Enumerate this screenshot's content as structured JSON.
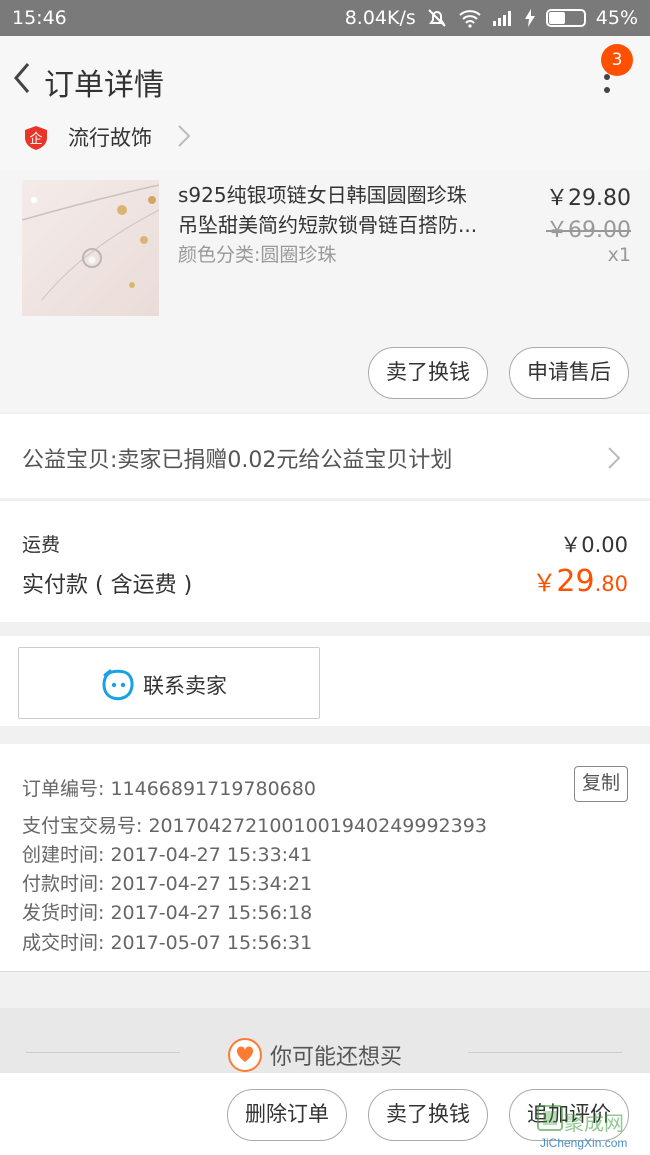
{
  "status_bar": {
    "time": "15:46",
    "speed": "8.04K/s",
    "battery": "45%"
  },
  "nav": {
    "title": "订单详情",
    "badge_count": "3"
  },
  "shop": {
    "name": "流行故饰"
  },
  "product": {
    "title_line1": "s925纯银项链女日韩国圆圈珍珠",
    "title_line2": "吊坠甜美简约短款锁骨链百搭防...",
    "sku": "颜色分类:圆圈珍珠",
    "price": "￥29.80",
    "original_price": "￥69.00",
    "quantity": "x1",
    "buttons": {
      "sell": "卖了换钱",
      "after_sale": "申请售后"
    }
  },
  "charity": {
    "text": "公益宝贝:卖家已捐赠0.02元给公益宝贝计划"
  },
  "fees": {
    "shipping_label": "运费",
    "shipping_value": "￥0.00",
    "paid_label": "实付款 ( 含运费 )",
    "paid_currency": "￥",
    "paid_integer": "29",
    "paid_decimal": ".80"
  },
  "contact": {
    "label": "联系卖家"
  },
  "order_info": {
    "copy_label": "复制",
    "rows": [
      "订单编号: 11466891719780680",
      "支付宝交易号: 2017042721001001940249992393",
      "创建时间: 2017-04-27 15:33:41",
      "付款时间: 2017-04-27 15:34:21",
      "发货时间: 2017-04-27 15:56:18",
      "成交时间: 2017-05-07 15:56:31"
    ]
  },
  "recommend": {
    "label": "你可能还想买"
  },
  "bottom_actions": {
    "delete": "删除订单",
    "sell": "卖了换钱",
    "review": "追加评价"
  },
  "watermark": {
    "brand": "聚成网",
    "url": "JiChengXin.com"
  },
  "colors": {
    "accent": "#ff5000",
    "badge": "#ff5000",
    "contact_icon": "#1aa0e8",
    "heart": "#ff7a32"
  }
}
